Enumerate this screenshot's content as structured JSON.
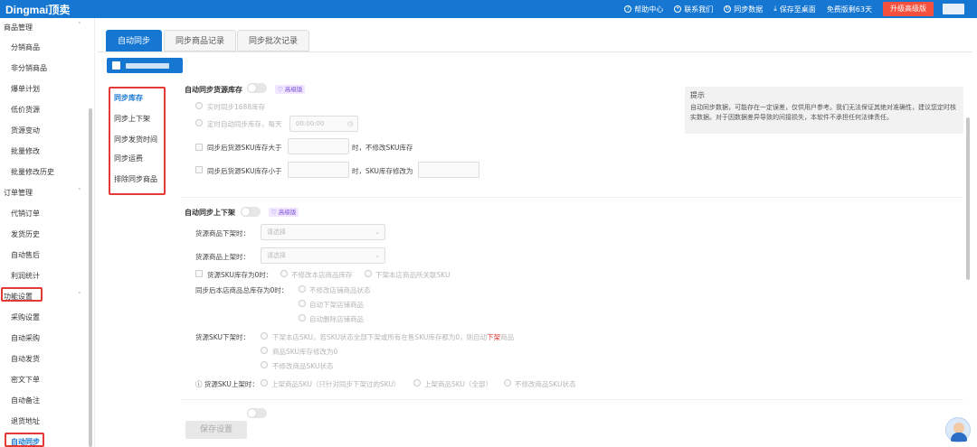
{
  "app": {
    "logo": "Dingmai顶卖",
    "top_links": [
      {
        "icon": "help-circle-icon",
        "label": "帮助中心"
      },
      {
        "icon": "contact-icon",
        "label": "联系我们"
      },
      {
        "icon": "sync-icon",
        "label": "同步数据"
      },
      {
        "icon": "download-icon",
        "label": "保存至桌面"
      },
      {
        "icon": "",
        "label": "免费版剩63天"
      }
    ],
    "upgrade_label": "升级高级版"
  },
  "sidebar": {
    "groups": [
      {
        "label": "商品管理",
        "items": [
          "分销商品",
          "非分销商品",
          "爆单计划",
          "低价货源",
          "货源变动",
          "批量修改",
          "批量修改历史"
        ]
      },
      {
        "label": "订单管理",
        "items": [
          "代销订单",
          "发货历史",
          "自动售后",
          "利润统计"
        ]
      },
      {
        "label": "功能设置",
        "items": [
          "采购设置",
          "自动采购",
          "自动发货",
          "密文下单",
          "自动备注",
          "退货地址",
          "自动同步"
        ]
      }
    ],
    "active": "自动同步"
  },
  "tabs": [
    "自动同步",
    "同步商品记录",
    "同步批次记录"
  ],
  "mini_nav": [
    "同步库存",
    "同步上下架",
    "同步发货时间",
    "同步运费",
    "排除同步商品"
  ],
  "stock": {
    "title": "自动同步货源库存",
    "badge": "高级版",
    "opt_realtime": "实时同步1688库存",
    "opt_timed": "定时自动同步库存，每天",
    "time_value": "00:00:00",
    "cond1_pre": "同步后货源SKU库存大于",
    "cond1_post": "时，不修改SKU库存",
    "cond2_pre": "同步后货源SKU库存小于",
    "cond2_post": "时，SKU库存修改为"
  },
  "tip": {
    "title": "提示",
    "body": "自动同步数据，可能存在一定误差，仅供用户参考。我们无法保证其绝对准确性，建议您定时核实数据。对于因数据差异导致的间接损失，本软件不承担任何法律责任。"
  },
  "shelf": {
    "title": "自动同步上下架",
    "badge": "高级版",
    "off_label": "货源商品下架时：",
    "on_label": "货源商品上架时：",
    "placeholder": "请选择",
    "sku_zero_label": "货源SKU库存为0时：",
    "sku_zero_opt1": "不修改本店商品库存",
    "sku_zero_opt2": "下架本店商品所关联SKU",
    "total_zero_label": "同步后本店商品总库存为0时：",
    "total_zero_opts": [
      "不修改店铺商品状态",
      "自动下架店铺商品",
      "自动删除店铺商品"
    ],
    "sku_off_label": "货源SKU下架时：",
    "sku_off_opt1_pre": "下架本店SKU。若SKU状态全部下架或所有在售SKU库存都为0，则自动",
    "sku_off_opt1_hl": "下架",
    "sku_off_opt1_post": "商品",
    "sku_off_opt2": "商品SKU库存修改为0",
    "sku_off_opt3": "不修改商品SKU状态",
    "sku_on_label": "货源SKU上架时：",
    "sku_on_opts": [
      "上架商品SKU（只针对同步下架过的SKU）",
      "上架商品SKU（全部）",
      "不修改商品SKU状态"
    ]
  },
  "save_label": "保存设置",
  "colors": {
    "primary": "#1677d2",
    "upgrade": "#f5503d",
    "highlight_box": "#e53935",
    "badge": "#7b4fd6"
  }
}
